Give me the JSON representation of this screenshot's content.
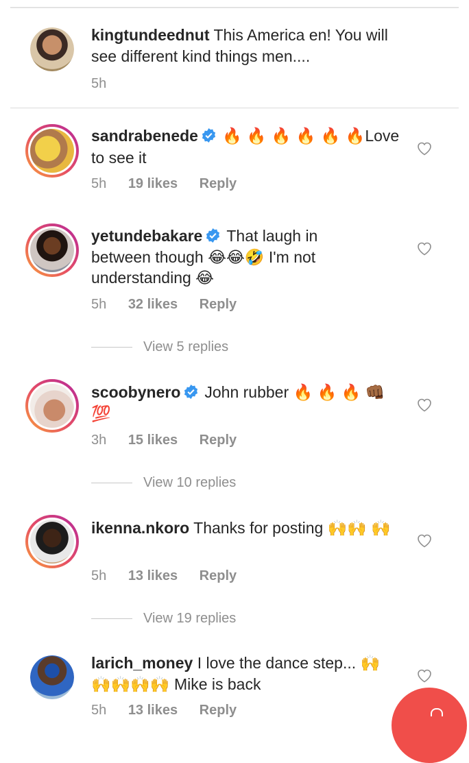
{
  "caption": {
    "username": "kingtundeednut",
    "text": "This America en! You will see different kind things men....",
    "time": "5h"
  },
  "comments": [
    {
      "username": "sandrabenede",
      "verified": true,
      "text_before": "",
      "emoji": "🔥 🔥 🔥 🔥 🔥 🔥",
      "text_after": "Love to see it",
      "time": "5h",
      "likes": "19 likes",
      "reply": "Reply"
    },
    {
      "username": "yetundebakare",
      "verified": true,
      "text": "That laugh in between though 😂😂🤣 I'm not understanding 😂",
      "time": "5h",
      "likes": "32 likes",
      "reply": "Reply",
      "view_replies": "View 5 replies"
    },
    {
      "username": "scoobynero",
      "verified": true,
      "text": "John rubber 🔥 🔥 🔥 👊🏾 💯",
      "time": "3h",
      "likes": "15 likes",
      "reply": "Reply",
      "view_replies": "View 10 replies"
    },
    {
      "username": "ikenna.nkoro",
      "verified": false,
      "text": "Thanks for posting 🙌🙌 🙌",
      "time": "5h",
      "likes": "13 likes",
      "reply": "Reply",
      "view_replies": "View 19 replies"
    },
    {
      "username": "larich_money",
      "verified": false,
      "text": "I love the dance step... 🙌 🙌🙌🙌🙌 Mike is back",
      "time": "5h",
      "likes": "13 likes",
      "reply": "Reply"
    }
  ],
  "colors": {
    "text": "#262626",
    "meta": "#8e8e8e",
    "verified": "#3897f0",
    "story_ring_start": "#f9a23c",
    "story_ring_end": "#b5289c",
    "fab": "#f04e4a"
  }
}
